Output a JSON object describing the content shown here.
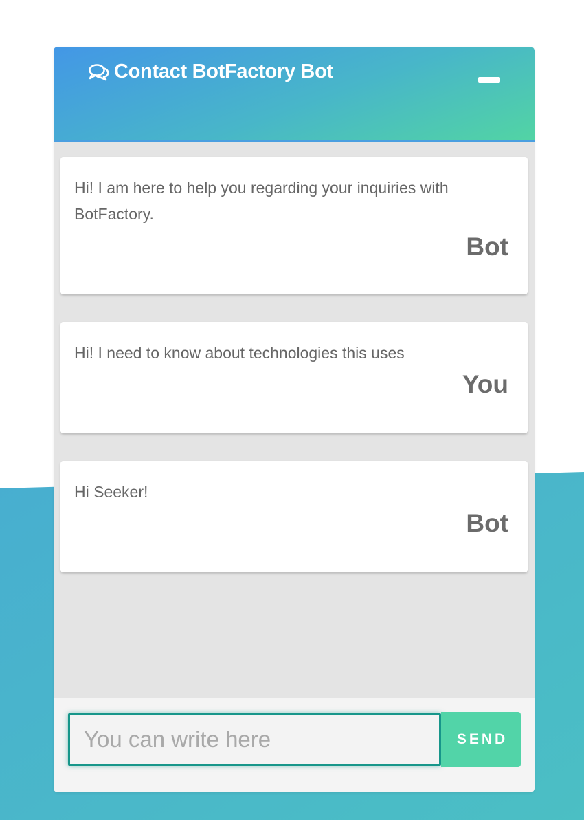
{
  "theme": {
    "header_gradient_start": "#4397e6",
    "header_gradient_end": "#52d4a4",
    "panel_background": "#e4e4e4",
    "send_button_color": "#52d4a8",
    "input_focus_border": "#17968a",
    "page_wave_color": "#46b2cc"
  },
  "header": {
    "icon": "chat-bubbles-icon",
    "title": "Contact BotFactory Bot",
    "minimize_icon": "minimize-icon"
  },
  "messages": [
    {
      "text": "Hi! I am here to help you regarding your inquiries with BotFactory.",
      "sender": "Bot"
    },
    {
      "text": "Hi! I need to know about technologies this uses",
      "sender": "You"
    },
    {
      "text": "Hi Seeker!",
      "sender": "Bot"
    }
  ],
  "composer": {
    "placeholder": "You can write here",
    "value": "",
    "send_label": "SEND"
  }
}
